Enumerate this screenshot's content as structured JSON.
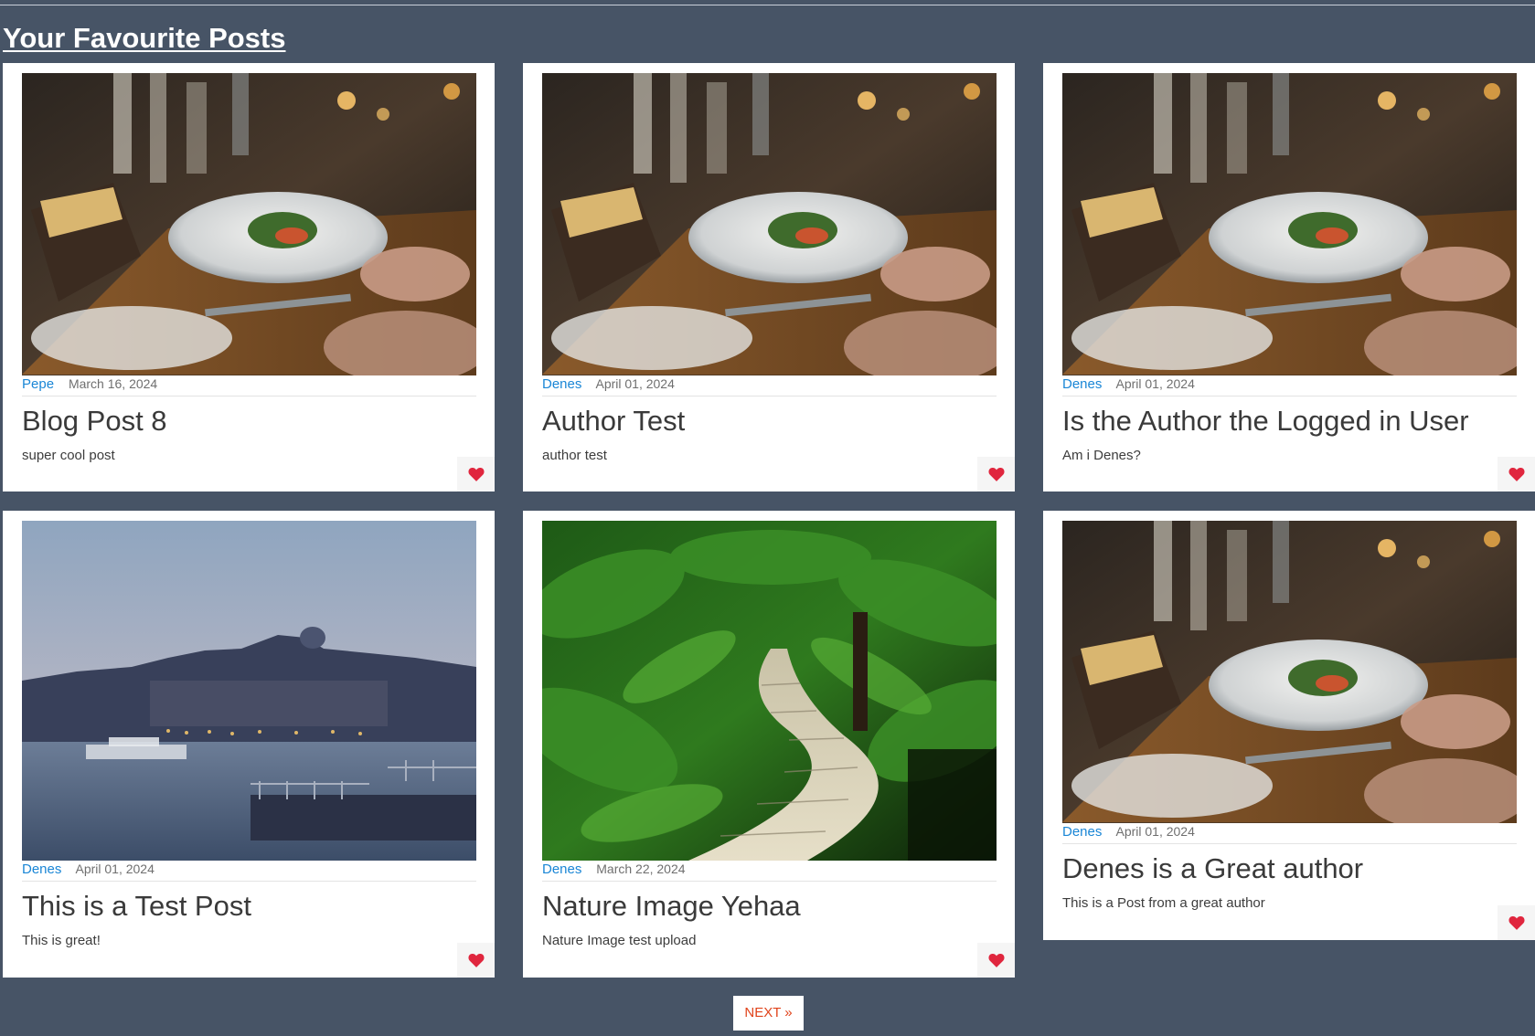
{
  "page": {
    "title": "Your Favourite Posts"
  },
  "posts": [
    {
      "author": "Pepe",
      "date": "March 16, 2024",
      "title": "Blog Post 8",
      "description": "super cool post",
      "image": "restaurant-dinner-table-photo",
      "favourite_icon": "heart-icon"
    },
    {
      "author": "Denes",
      "date": "April 01, 2024",
      "title": "Author Test",
      "description": "author test",
      "image": "restaurant-dinner-table-photo",
      "favourite_icon": "heart-icon"
    },
    {
      "author": "Denes",
      "date": "April 01, 2024",
      "title": "Is the Author the Logged in User",
      "description": "Am i Denes?",
      "image": "restaurant-dinner-table-photo",
      "favourite_icon": "heart-icon"
    },
    {
      "author": "Denes",
      "date": "April 01, 2024",
      "title": "This is a Test Post",
      "description": "This is great!",
      "image": "riverside-castle-city-photo",
      "favourite_icon": "heart-icon"
    },
    {
      "author": "Denes",
      "date": "March 22, 2024",
      "title": "Nature Image Yehaa",
      "description": "Nature Image test upload",
      "image": "forest-fern-path-photo",
      "favourite_icon": "heart-icon"
    },
    {
      "author": "Denes",
      "date": "April 01, 2024",
      "title": "Denes is a Great author",
      "description": "This is a Post from a great author",
      "image": "restaurant-dinner-table-photo",
      "favourite_icon": "heart-icon"
    }
  ],
  "pagination": {
    "next_label": "NEXT »"
  },
  "colors": {
    "background": "#475466",
    "author_link": "#1a86d6",
    "heart": "#e0263e",
    "next_text": "#e0431b"
  }
}
